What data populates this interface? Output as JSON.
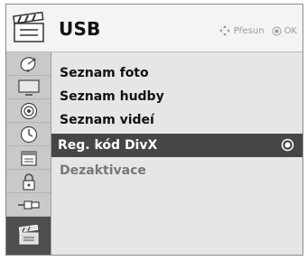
{
  "header": {
    "title": "USB",
    "hint_move": "Přesun",
    "hint_ok": "OK",
    "icon": "clapperboard-icon"
  },
  "sidebar": {
    "items": [
      {
        "icon": "satellite-dish-icon",
        "active": false
      },
      {
        "icon": "tv-screen-icon",
        "active": false
      },
      {
        "icon": "speaker-icon",
        "active": false
      },
      {
        "icon": "clock-icon",
        "active": false
      },
      {
        "icon": "calendar-icon",
        "active": false
      },
      {
        "icon": "padlock-icon",
        "active": false
      },
      {
        "icon": "usb-plug-icon",
        "active": false
      },
      {
        "icon": "clapperboard-icon",
        "active": true
      }
    ]
  },
  "menu": {
    "items": [
      {
        "label": "Seznam foto",
        "state": "normal"
      },
      {
        "label": "Seznam hudby",
        "state": "normal"
      },
      {
        "label": "Seznam videí",
        "state": "normal"
      },
      {
        "label": "Reg. kód DivX",
        "state": "selected"
      },
      {
        "label": "Dezaktivace",
        "state": "disabled"
      }
    ]
  },
  "colors": {
    "selected_bg": "#464646",
    "panel_bg": "#e6e6e6",
    "sidebar_bg": "#c9c9c9",
    "active_sidebar_bg": "#4e4e4e"
  }
}
